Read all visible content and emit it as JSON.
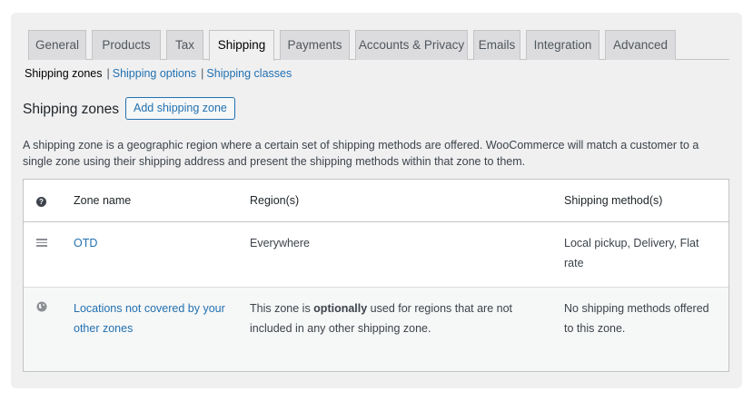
{
  "tabs": [
    {
      "label": "General"
    },
    {
      "label": "Products"
    },
    {
      "label": "Tax"
    },
    {
      "label": "Shipping",
      "active": true
    },
    {
      "label": "Payments"
    },
    {
      "label": "Accounts & Privacy"
    },
    {
      "label": "Emails"
    },
    {
      "label": "Integration"
    },
    {
      "label": "Advanced"
    }
  ],
  "subnav": {
    "items": [
      {
        "label": "Shipping zones",
        "current": true
      },
      {
        "label": "Shipping options"
      },
      {
        "label": "Shipping classes"
      }
    ],
    "separator": "|"
  },
  "page": {
    "heading": "Shipping zones",
    "add_button": "Add shipping zone",
    "description": "A shipping zone is a geographic region where a certain set of shipping methods are offered. WooCommerce will match a customer to a single zone using their shipping address and present the shipping methods within that zone to them."
  },
  "table": {
    "headers": {
      "help_icon": "?",
      "zone_name": "Zone name",
      "regions": "Region(s)",
      "methods": "Shipping method(s)"
    },
    "rows": [
      {
        "icon": "drag-handle-icon",
        "zone_name": "OTD",
        "regions": "Everywhere",
        "methods": "Local pickup, Delivery, Flat rate"
      },
      {
        "icon": "globe-icon",
        "zone_name": "Locations not covered by your other zones",
        "regions_prefix": "This zone is ",
        "regions_bold": "optionally",
        "regions_suffix": " used for regions that are not included in any other shipping zone.",
        "methods": "No shipping methods offered to this zone."
      }
    ]
  },
  "colors": {
    "accent": "#2271b1",
    "panel_bg": "#f0f0f1",
    "tab_bg": "#dcdcde",
    "border": "#c3c4c7"
  }
}
